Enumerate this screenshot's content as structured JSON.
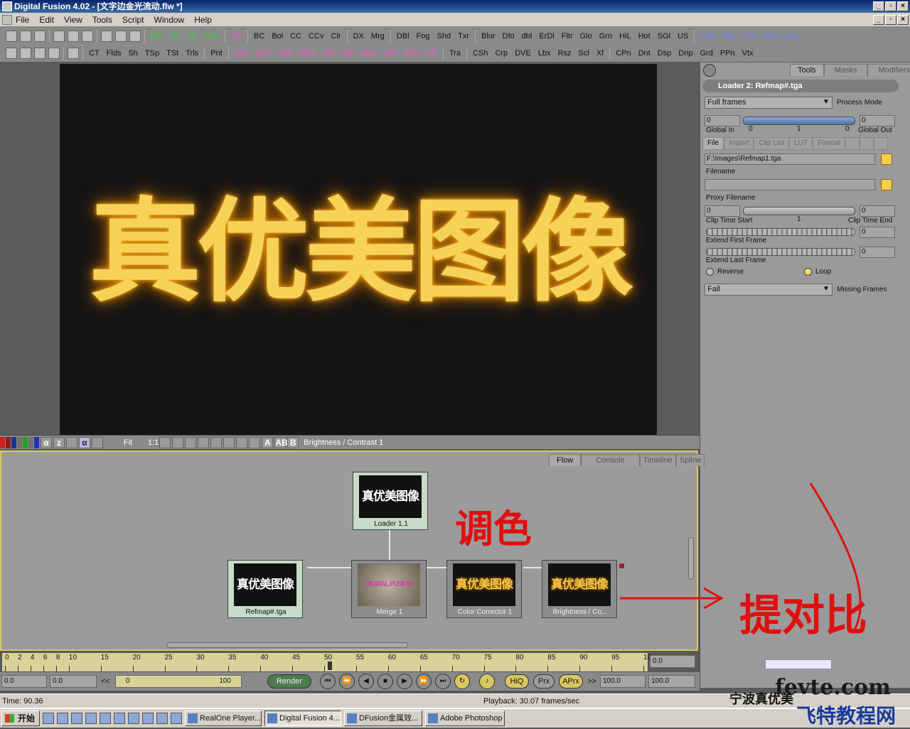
{
  "window": {
    "title": "Digital Fusion 4.02 - [文字边金光流动.flw *]",
    "min": "_",
    "max": "▫",
    "close": "×"
  },
  "menu": [
    "File",
    "Edit",
    "View",
    "Tools",
    "Script",
    "Window",
    "Help"
  ],
  "toolbar1": {
    "green": [
      "BG",
      "FN",
      "LD",
      "Txt+"
    ],
    "pink": [
      "SV"
    ],
    "plain1": [
      "BC",
      "Bol",
      "CC",
      "CCv",
      "Clr"
    ],
    "plain2": [
      "DX",
      "Mrg"
    ],
    "plain3": [
      "DBl",
      "Fog",
      "Shd",
      "Txr"
    ],
    "plain4": [
      "Blur",
      "Dfo",
      "dbl",
      "ErDl",
      "Fltr",
      "Glo",
      "Grn",
      "HiL",
      "Hot",
      "SGl",
      "US"
    ],
    "blue": [
      "CKy",
      "DKy",
      "LKy",
      "Mat",
      "UKy"
    ]
  },
  "toolbar2": {
    "plain1": [
      "CT",
      "Flds",
      "Sh",
      "TSp",
      "TSt",
      "Trls"
    ],
    "plain2": [
      "Pnt"
    ],
    "pink": [
      "pBn",
      "pCS",
      "pDF",
      "pEm",
      "pFr",
      "pIE",
      "pMg",
      "pPF",
      "pRn",
      "pTr"
    ],
    "plain3": [
      "Tra"
    ],
    "plain4": [
      "CSh",
      "Crp",
      "DVE",
      "Lbx",
      "Rsz",
      "Scl",
      "Xf"
    ],
    "plain5": [
      "CPn",
      "Dnt",
      "Dsp",
      "Drip",
      "Grd",
      "PPn",
      "Vtx"
    ]
  },
  "viewer": {
    "text": "真优美图像",
    "fit_label": "Fit",
    "ratio_label": "1:1",
    "alpha_label": "α",
    "z_label": "z",
    "a_label": "A",
    "ab_label": "AB",
    "b_label": "B",
    "view_name": "Brightness / Contrast 1"
  },
  "panel": {
    "tabs": [
      "Tools",
      "Masks",
      "Modifiers"
    ],
    "header": "Loader 2: Refmap#.tga",
    "process_mode_value": "Full frames",
    "process_mode_label": "Process Mode",
    "global_in_value": "0",
    "global_out_value": "0",
    "global_in_label": "Global In",
    "global_out_label": "Global Out",
    "range_min": "0",
    "range_mid": "1",
    "range_max": "0",
    "subtabs": [
      "File",
      "Import",
      "Clip List",
      "LUT",
      "Format"
    ],
    "filename_value": "F:\\Images\\Refmap1.tga",
    "filename_label": "Filename",
    "proxy_label": "Proxy Filename",
    "clip_start_value": "0",
    "clip_end_value": "0",
    "clip_mid": "1",
    "clip_start_label": "Clip Time Start",
    "clip_end_label": "Clip Time End",
    "extend_first_value": "0",
    "extend_first_label": "Extend First Frame",
    "extend_last_value": "0",
    "extend_last_label": "Extend Last Frame",
    "reverse_label": "Reverse",
    "loop_label": "Loop",
    "missing_value": "Fail",
    "missing_label": "Missing Frames"
  },
  "flow": {
    "tabs": [
      "Flow",
      "Console",
      "Timeline",
      "Spline"
    ],
    "nodes": {
      "loader": {
        "label": "Loader 1.1",
        "thumb": "真优美图像"
      },
      "refmap": {
        "label": "Refmap#.tga",
        "thumb": "真优美图像"
      },
      "merge": {
        "label": "Merge 1",
        "thumb": "DIGITAL FUSION"
      },
      "cc": {
        "label": "Color Corrector 1",
        "thumb": "真优美图像"
      },
      "bc": {
        "label": "Brightness / Co...",
        "thumb": "真优美图像"
      }
    }
  },
  "timeline": {
    "ticks": [
      "0",
      "2",
      "4",
      "6",
      "8",
      "10",
      "15",
      "20",
      "25",
      "30",
      "35",
      "40",
      "45",
      "50",
      "55",
      "60",
      "65",
      "70",
      "75",
      "80",
      "85",
      "90",
      "95",
      "10"
    ],
    "current": "0.0"
  },
  "transport": {
    "start": "0.0",
    "start2": "0.0",
    "range_start": "0",
    "range_end": "100",
    "render_label": "Render",
    "hiq": "HiQ",
    "prx": "Prx",
    "aprx": "APrx",
    "end": "100.0",
    "end2": "100.0",
    "prev_label": "<<",
    "next_label": ">>"
  },
  "status": {
    "time": "Time: 90.36",
    "playback": "Playback: 30.07 frames/sec"
  },
  "taskbar": {
    "start": "开始",
    "buttons": [
      "RealOne Player...",
      "Digital Fusion 4....",
      "DFusion金属效...",
      "Adobe Photoshop"
    ]
  },
  "annotations": {
    "anno1": "调色",
    "anno2": "提对比",
    "watermark_cn": "宁波真优美",
    "watermark_url": "fevte.com",
    "watermark_site": "飞特教程网"
  },
  "colors": {
    "accent_title": "#0a246a",
    "flow_border": "#d8c860",
    "annotation_red": "#e01010"
  }
}
